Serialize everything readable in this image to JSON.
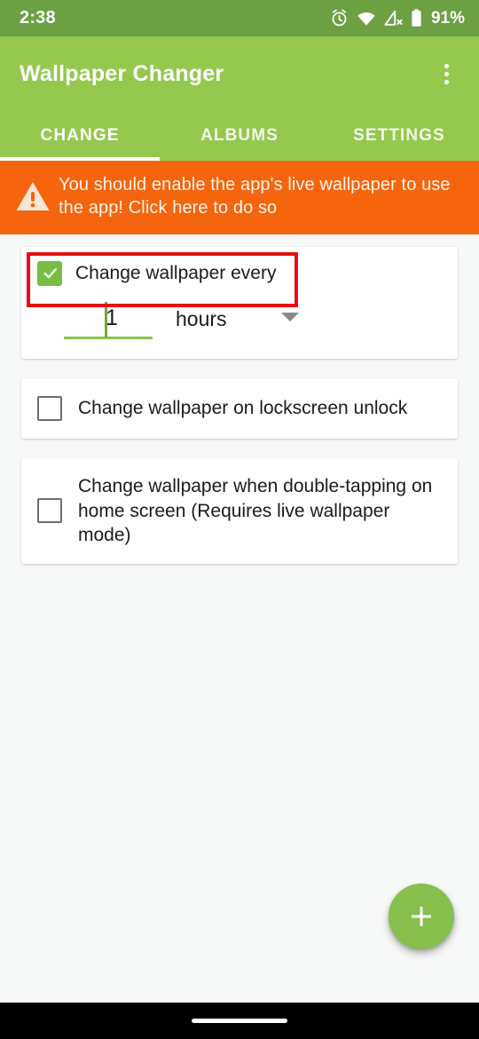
{
  "status_bar": {
    "time": "2:38",
    "battery_percent": "91%",
    "icons": [
      "alarm-icon",
      "wifi-icon",
      "cell-signal-off-icon",
      "battery-icon"
    ]
  },
  "app_bar": {
    "title": "Wallpaper Changer",
    "overflow_menu": "overflow-menu-icon"
  },
  "tabs": {
    "items": [
      {
        "label": "CHANGE",
        "active": true
      },
      {
        "label": "ALBUMS",
        "active": false
      },
      {
        "label": "SETTINGS",
        "active": false
      }
    ]
  },
  "warning_banner": {
    "icon": "warning-triangle-icon",
    "text": "You should enable the app's live wallpaper to use the app! Click here to do so",
    "background_color": "#f4650d"
  },
  "options": {
    "interval": {
      "checkbox_label": "Change wallpaper every",
      "checked": true,
      "value": "1",
      "unit": "hours",
      "dropdown_icon": "chevron-down-icon",
      "highlighted": true,
      "highlight_color": "#e60f12"
    },
    "lockscreen": {
      "checkbox_label": "Change wallpaper on lockscreen unlock",
      "checked": false
    },
    "double_tap": {
      "checkbox_label": "Change wallpaper when double-tapping on home screen (Requires live wallpaper mode)",
      "checked": false
    }
  },
  "fab": {
    "icon": "plus-icon",
    "color": "#86bf4c"
  },
  "nav_bar": {
    "handle": "gesture-pill"
  },
  "theme": {
    "status_bar_color": "#6ba043",
    "app_bar_color": "#94c94e",
    "accent_color": "#8ec14f",
    "background_color": "#f7f8f8"
  }
}
